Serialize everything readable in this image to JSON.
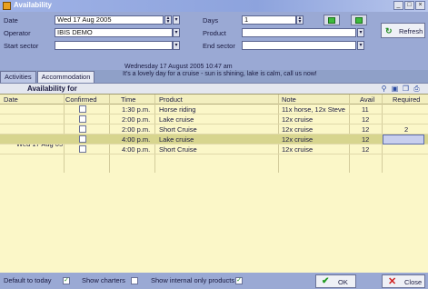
{
  "window": {
    "title": "Availability",
    "min_label": "_",
    "max_label": "□",
    "close_label": "×"
  },
  "form": {
    "date_label": "Date",
    "date_value": "Wed 17 Aug 2005",
    "operator_label": "Operator",
    "operator_value": "IBIS DEMO",
    "start_sector_label": "Start sector",
    "start_sector_value": "",
    "days_label": "Days",
    "days_value": "1",
    "product_label": "Product",
    "product_value": "",
    "end_sector_label": "End sector",
    "end_sector_value": "",
    "refresh_label": "Refresh"
  },
  "tabs": [
    {
      "label": "Activities",
      "active": false
    },
    {
      "label": "Accommodation",
      "active": true
    }
  ],
  "message": {
    "line1": "Wednesday  17 August 2005  10:47 am",
    "line2": "It's a lovely day for a cruise - sun is shining, lake is calm, call us now!"
  },
  "availability": {
    "heading": "Availability for",
    "columns": {
      "date": "Date",
      "confirmed": "Confirmed",
      "time": "Time",
      "product": "Product",
      "note": "Note",
      "avail": "Avail",
      "required": "Required"
    },
    "date_group": "Wed 17 Aug 05",
    "rows": [
      {
        "time": "1:30 p.m.",
        "product": "Horse riding",
        "note": "11x horse, 12x Steve",
        "avail": "11",
        "required": "",
        "confirmed": false
      },
      {
        "time": "2:00 p.m.",
        "product": "Lake cruise",
        "note": "12x cruise",
        "avail": "12",
        "required": "",
        "confirmed": false
      },
      {
        "time": "2:00 p.m.",
        "product": "Short Cruise",
        "note": "12x cruise",
        "avail": "12",
        "required": "2",
        "confirmed": false
      },
      {
        "time": "4:00 p.m.",
        "product": "Lake cruise",
        "note": "12x cruise",
        "avail": "12",
        "required": "",
        "confirmed": false,
        "selected": true
      },
      {
        "time": "4:00 p.m.",
        "product": "Short Cruise",
        "note": "12x cruise",
        "avail": "12",
        "required": "",
        "confirmed": false
      }
    ]
  },
  "footer": {
    "default_today_label": "Default to today",
    "default_today_checked": true,
    "show_charters_label": "Show charters",
    "show_charters_checked": false,
    "show_internal_label": "Show internal only products",
    "show_internal_checked": true,
    "ok_label": "OK",
    "close_label": "Close"
  },
  "colors": {
    "grid_bg": "#fbf7c8",
    "selected_row": "#d7d58e",
    "form_bg": "#9aa9d4",
    "ok_green": "#1f9a1f",
    "close_red": "#d02020"
  }
}
